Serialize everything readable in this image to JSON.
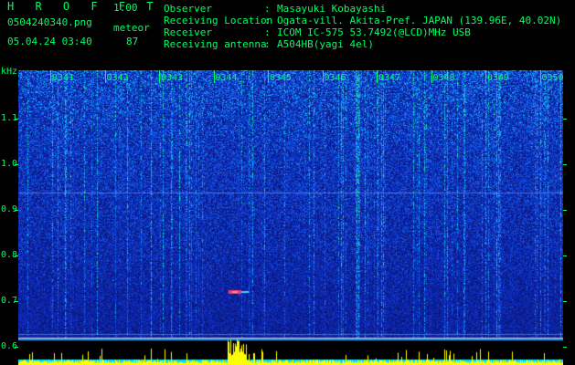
{
  "app": {
    "brand": "H R O F F T",
    "version": "1.00"
  },
  "file": {
    "name": "0504240340.png",
    "datetime": "05.04.24 03:40"
  },
  "meteor": {
    "label": "meteor",
    "count": "87"
  },
  "info": [
    {
      "key": "Observer",
      "value": "Masayuki Kobayashi"
    },
    {
      "key": "Receiving Location",
      "value": "Ogata-vill. Akita-Pref. JAPAN (139.96E, 40.02N)"
    },
    {
      "key": "Receiver",
      "value": "ICOM IC-575 53.7492(@LCD)MHz USB"
    },
    {
      "key": "Receiving antenna",
      "value": "A504HB(yagi 4el)"
    }
  ],
  "axis": {
    "unit": "kHz",
    "y_ticks": [
      "1.1",
      "1.0",
      "0.9",
      "0.8",
      "0.7",
      "0.6"
    ],
    "x_ticks": [
      "0341",
      "0342",
      "0343",
      "0344",
      "0345",
      "0346",
      "0347",
      "0348",
      "0349",
      "0350"
    ]
  },
  "colors": {
    "text": "#00ff66",
    "background": "#000000",
    "spectrum_base": "#0a1f9a",
    "echo": "#ff3366",
    "baseline_bars": "#ffff00"
  }
}
